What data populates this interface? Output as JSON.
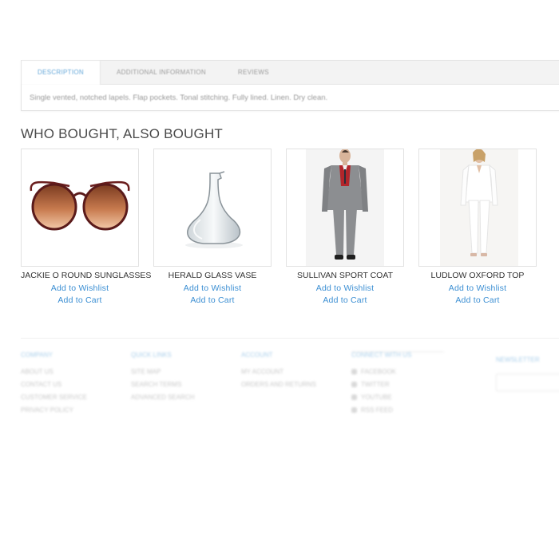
{
  "tabs": {
    "items": [
      "Description",
      "Additional Information",
      "Reviews"
    ],
    "content": "Single vented, notched lapels. Flap pockets. Tonal stitching. Fully lined. Linen. Dry clean."
  },
  "section": {
    "title": "WHO BOUGHT, ALSO BOUGHT"
  },
  "products": [
    {
      "name": "JACKIE O ROUND SUNGLASSES",
      "wishlist": "Add to Wishlist",
      "cart": "Add to Cart",
      "image": "sunglasses"
    },
    {
      "name": "HERALD GLASS VASE",
      "wishlist": "Add to Wishlist",
      "cart": "Add to Cart",
      "image": "glass-vase"
    },
    {
      "name": "SULLIVAN SPORT COAT",
      "wishlist": "Add to Wishlist",
      "cart": "Add to Cart",
      "image": "man-grey-suit"
    },
    {
      "name": "LUDLOW OXFORD TOP",
      "wishlist": "Add to Wishlist",
      "cart": "Add to Cart",
      "image": "woman-white-outfit"
    }
  ],
  "footer": {
    "columns": [
      {
        "title": "Company",
        "items": [
          "About us",
          "Contact us",
          "Customer Service",
          "Privacy Policy"
        ]
      },
      {
        "title": "Quick Links",
        "items": [
          "Site Map",
          "Search Terms",
          "Advanced Search"
        ]
      },
      {
        "title": "Account",
        "items": [
          "My Account",
          "Orders and Returns"
        ]
      },
      {
        "title": "Connect With Us",
        "items": [
          "Facebook",
          "Twitter",
          "YouTube",
          "RSS Feed"
        ]
      }
    ],
    "newsletter_title": "Newsletter"
  },
  "colors": {
    "accent": "#3c8fd3",
    "tab_active": "#62a6d8"
  }
}
